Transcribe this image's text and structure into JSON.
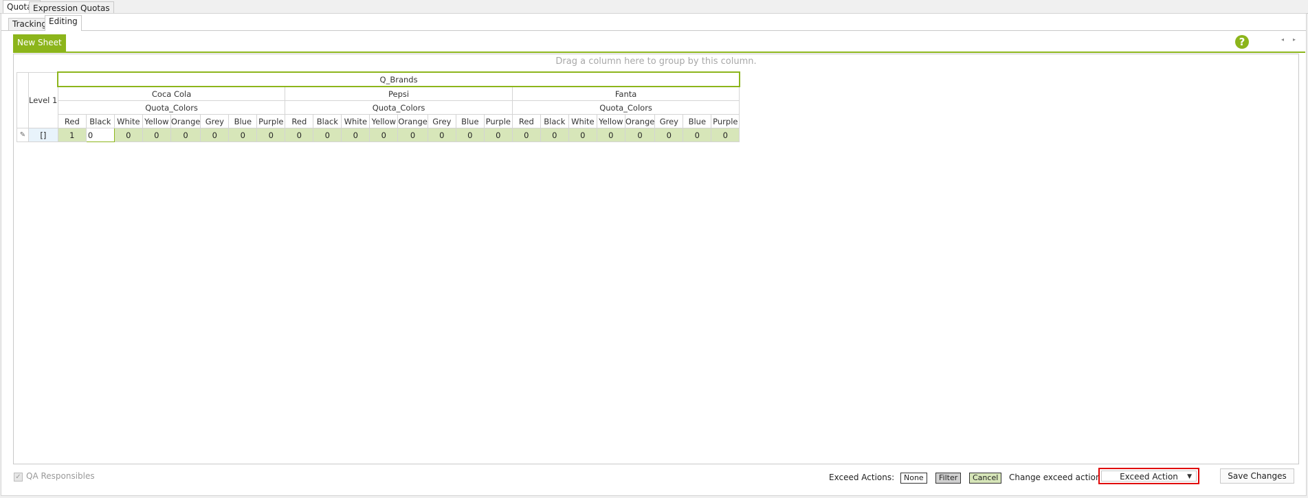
{
  "top_tabs": [
    {
      "label": "Quotas",
      "active": true
    },
    {
      "label": "Expression Quotas",
      "active": false
    }
  ],
  "sub_tabs": [
    {
      "label": "Tracking",
      "active": false
    },
    {
      "label": "Editing",
      "active": true
    }
  ],
  "sheet_tab": {
    "label": "New Sheet"
  },
  "help_icon": "question-mark-icon",
  "grid": {
    "group_hint": "Drag a column here to group by this column.",
    "root_header": "Q_Brands",
    "level_header": "Level 1",
    "brands": [
      {
        "name": "Coca Cola",
        "sub": "Quota_Colors"
      },
      {
        "name": "Pepsi",
        "sub": "Quota_Colors"
      },
      {
        "name": "Fanta",
        "sub": "Quota_Colors"
      }
    ],
    "colors": [
      "Red",
      "Black",
      "White",
      "Yellow",
      "Orange",
      "Grey",
      "Blue",
      "Purple"
    ],
    "rows": [
      {
        "indicator": "pencil-icon",
        "key": "[]",
        "values": [
          "1",
          "0",
          "0",
          "0",
          "0",
          "0",
          "0",
          "0",
          "0",
          "0",
          "0",
          "0",
          "0",
          "0",
          "0",
          "0",
          "0",
          "0",
          "0",
          "0",
          "0",
          "0",
          "0",
          "0"
        ]
      }
    ]
  },
  "bottom": {
    "qa_responsibles": {
      "label": "QA Responsibles",
      "checked": true,
      "disabled": true
    },
    "exceed_actions_label": "Exceed Actions:",
    "exceed_actions": [
      "None",
      "Filter",
      "Cancel"
    ],
    "change_label": "Change exceed action to:",
    "exceed_select_value": "Exceed Action",
    "save_label": "Save Changes"
  },
  "colors": {
    "accent": "#8cb51b",
    "cell_fill": "#d7e6b9",
    "highlight_border": "#e00000"
  }
}
